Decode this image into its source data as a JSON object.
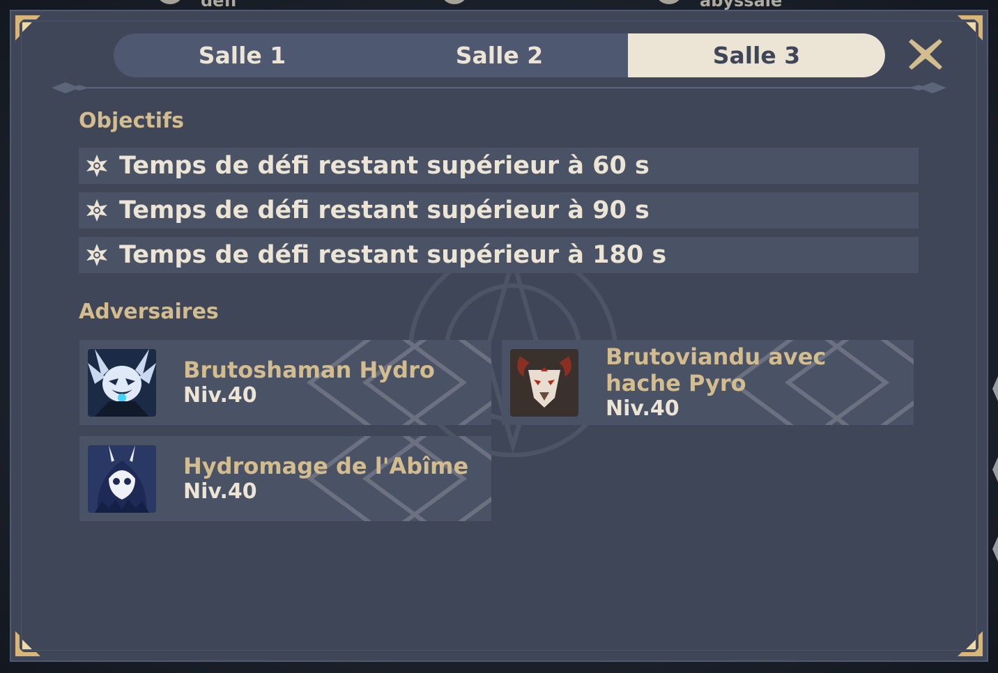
{
  "background": {
    "top_texts": [
      "défi",
      "abyssale"
    ]
  },
  "tabs": [
    {
      "label": "Salle 1",
      "active": false
    },
    {
      "label": "Salle 2",
      "active": false
    },
    {
      "label": "Salle 3",
      "active": true
    }
  ],
  "close_icon": "close-icon",
  "objectives": {
    "title": "Objectifs",
    "items": [
      {
        "text": "Temps de défi restant supérieur à 60 s",
        "icon": "star-icon"
      },
      {
        "text": "Temps de défi restant supérieur à 90 s",
        "icon": "star-icon"
      },
      {
        "text": "Temps de défi restant supérieur à 180 s",
        "icon": "star-icon"
      }
    ]
  },
  "adversaries": {
    "title": "Adversaires",
    "items": [
      {
        "name": "Brutoshaman Hydro",
        "level": "Niv.40",
        "portrait": "hydro-shaman-portrait"
      },
      {
        "name": "Brutoviandu avec hache Pyro",
        "level": "Niv.40",
        "portrait": "pyro-axe-mitachurl-portrait"
      },
      {
        "name": "Hydromage de l'Abîme",
        "level": "Niv.40",
        "portrait": "hydro-abyss-mage-portrait"
      }
    ]
  },
  "colors": {
    "panel": "#3e4658",
    "accent_gold": "#d3bc8e",
    "text_light": "#ece5d6",
    "tab_bar": "#4e5971"
  }
}
